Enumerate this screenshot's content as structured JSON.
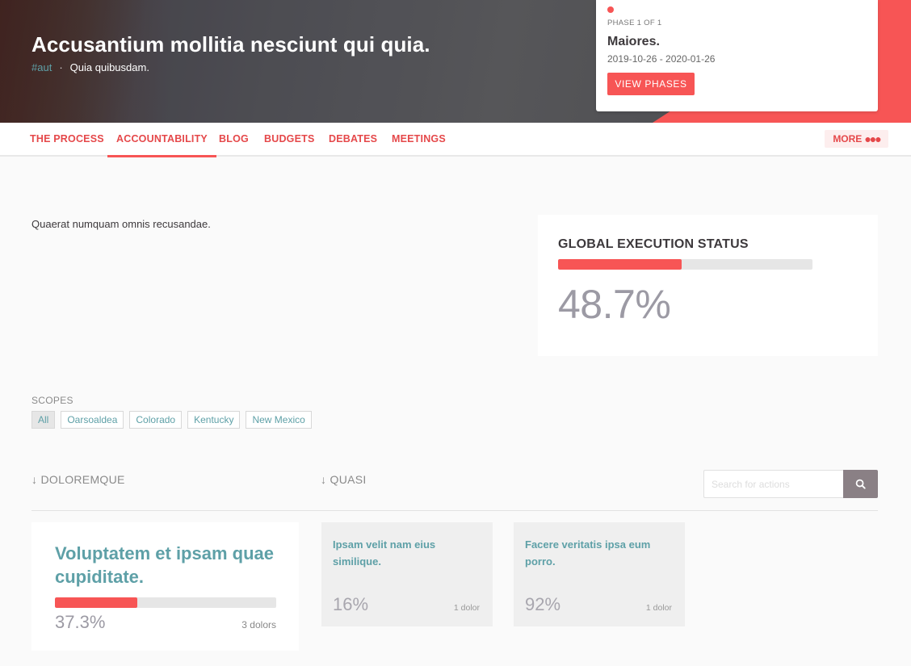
{
  "hero": {
    "title": "Accusantium mollitia nesciunt qui quia.",
    "hashtag": "#aut",
    "separator": "·",
    "subtitle": "Quia quibusdam."
  },
  "phase": {
    "label": "PHASE 1 OF 1",
    "name": "Maiores.",
    "dates": "2019-10-26 - 2020-01-26",
    "button": "VIEW PHASES"
  },
  "nav": {
    "items": [
      {
        "label": "THE PROCESS"
      },
      {
        "label": "ACCOUNTABILITY"
      },
      {
        "label": "BLOG"
      },
      {
        "label": "BUDGETS"
      },
      {
        "label": "DEBATES"
      },
      {
        "label": "MEETINGS"
      }
    ],
    "active": "ACCOUNTABILITY",
    "more": "MORE"
  },
  "description": "Quaerat numquam omnis recusandae.",
  "global_status": {
    "title": "GLOBAL EXECUTION STATUS",
    "percent_text": "48.7%",
    "progress": 48.7
  },
  "scopes": {
    "label": "SCOPES",
    "items": [
      "All",
      "Oarsoaldea",
      "Colorado",
      "Kentucky",
      "New Mexico"
    ],
    "active": "All"
  },
  "sort": {
    "first": "DOLOREMQUE",
    "second": "QUASI",
    "arrow": "↓"
  },
  "search": {
    "placeholder": "Search for actions"
  },
  "main_result": {
    "title": "Voluptatem et ipsam quae cupiditate.",
    "percent_text": "37.3%",
    "progress": 37.3,
    "count": "3 dolors"
  },
  "results": [
    {
      "title": "Ipsam velit nam eius similique.",
      "percent_text": "16%",
      "count": "1 dolor"
    },
    {
      "title": "Facere veritatis ipsa eum porro.",
      "percent_text": "92%",
      "count": "1 dolor"
    }
  ],
  "colors": {
    "accent": "#f75555",
    "link": "#5ea0a7",
    "muted_value": "#9c9aa4"
  },
  "icons": {
    "search": "search-icon",
    "more": "more-dots-icon",
    "sort": "arrow-down-icon"
  }
}
